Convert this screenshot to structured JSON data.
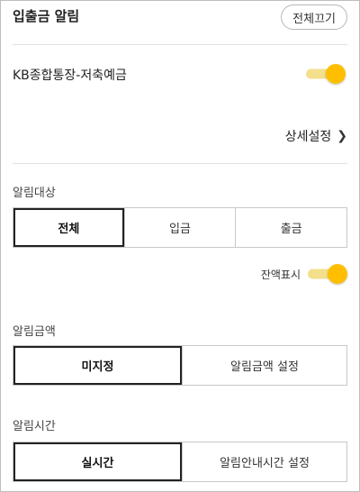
{
  "header": {
    "title": "입출금 알림",
    "all_off_label": "전체끄기"
  },
  "account": {
    "name": "KB종합통장-저축예금",
    "toggle_on": true
  },
  "detail_settings_label": "상세설정",
  "target_section": {
    "label": "알림대상",
    "options": [
      "전체",
      "입금",
      "출금"
    ],
    "selected": "전체"
  },
  "balance": {
    "label": "잔액표시",
    "toggle_on": true
  },
  "amount_section": {
    "label": "알림금액",
    "options": [
      "미지정",
      "알림금액 설정"
    ],
    "selected": "미지정"
  },
  "time_section": {
    "label": "알림시간",
    "options": [
      "실시간",
      "알림안내시간 설정"
    ],
    "selected": "실시간"
  },
  "colors": {
    "toggle_knob": "#ffbf00",
    "toggle_track": "#f3df8c",
    "selected_border": "#222222"
  }
}
